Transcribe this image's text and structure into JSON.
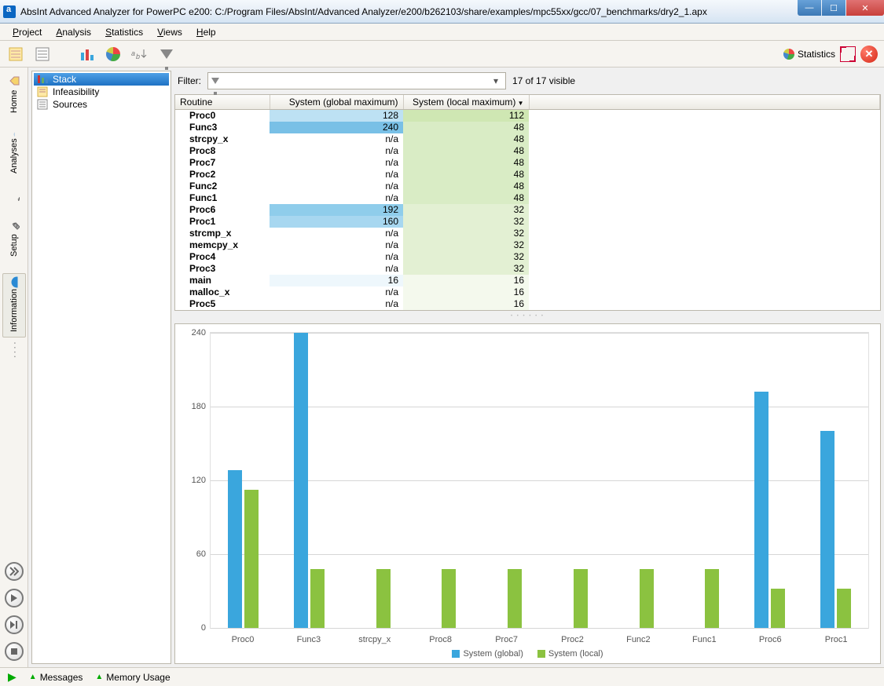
{
  "window": {
    "title": "AbsInt Advanced Analyzer for PowerPC e200: C:/Program Files/AbsInt/Advanced Analyzer/e200/b262103/share/examples/mpc55xx/gcc/07_benchmarks/dry2_1.apx"
  },
  "menus": {
    "project": "Project",
    "analysis": "Analysis",
    "statistics": "Statistics",
    "views": "Views",
    "help": "Help"
  },
  "toolbar": {
    "stats_label": "Statistics"
  },
  "vtabs": {
    "home": "Home",
    "analyses": "Analyses",
    "setup": "Setup",
    "information": "Information"
  },
  "tree": {
    "items": [
      "Stack",
      "Infeasibility",
      "Sources"
    ]
  },
  "filter": {
    "label": "Filter:",
    "visible_text": "17 of 17 visible"
  },
  "table": {
    "headers": [
      "Routine",
      "System (global maximum)",
      "System (local maximum)"
    ],
    "rows": [
      {
        "routine": "Proc0",
        "global": "128",
        "local": "112",
        "g_bg": "#bde1f3",
        "l_bg": "#cfe7b3"
      },
      {
        "routine": "Func3",
        "global": "240",
        "local": "48",
        "g_bg": "#79c0e6",
        "l_bg": "#d9ecc5"
      },
      {
        "routine": "strcpy_x",
        "global": "n/a",
        "local": "48",
        "g_bg": "",
        "l_bg": "#d9ecc5"
      },
      {
        "routine": "Proc8",
        "global": "n/a",
        "local": "48",
        "g_bg": "",
        "l_bg": "#d9ecc5"
      },
      {
        "routine": "Proc7",
        "global": "n/a",
        "local": "48",
        "g_bg": "",
        "l_bg": "#d9ecc5"
      },
      {
        "routine": "Proc2",
        "global": "n/a",
        "local": "48",
        "g_bg": "",
        "l_bg": "#d9ecc5"
      },
      {
        "routine": "Func2",
        "global": "n/a",
        "local": "48",
        "g_bg": "",
        "l_bg": "#d9ecc5"
      },
      {
        "routine": "Func1",
        "global": "n/a",
        "local": "48",
        "g_bg": "",
        "l_bg": "#d9ecc5"
      },
      {
        "routine": "Proc6",
        "global": "192",
        "local": "32",
        "g_bg": "#8fcdeb",
        "l_bg": "#e3f0d3"
      },
      {
        "routine": "Proc1",
        "global": "160",
        "local": "32",
        "g_bg": "#a7d7f0",
        "l_bg": "#e3f0d3"
      },
      {
        "routine": "strcmp_x",
        "global": "n/a",
        "local": "32",
        "g_bg": "",
        "l_bg": "#e3f0d3"
      },
      {
        "routine": "memcpy_x",
        "global": "n/a",
        "local": "32",
        "g_bg": "",
        "l_bg": "#e3f0d3"
      },
      {
        "routine": "Proc4",
        "global": "n/a",
        "local": "32",
        "g_bg": "",
        "l_bg": "#e3f0d3"
      },
      {
        "routine": "Proc3",
        "global": "n/a",
        "local": "32",
        "g_bg": "",
        "l_bg": "#e3f0d3"
      },
      {
        "routine": "main",
        "global": "16",
        "local": "16",
        "g_bg": "#eef7fc",
        "l_bg": "#f4f9ed"
      },
      {
        "routine": "malloc_x",
        "global": "n/a",
        "local": "16",
        "g_bg": "",
        "l_bg": "#f4f9ed"
      },
      {
        "routine": "Proc5",
        "global": "n/a",
        "local": "16",
        "g_bg": "",
        "l_bg": "#f4f9ed"
      }
    ]
  },
  "chart_data": {
    "type": "bar",
    "categories": [
      "Proc0",
      "Func3",
      "strcpy_x",
      "Proc8",
      "Proc7",
      "Proc2",
      "Func2",
      "Func1",
      "Proc6",
      "Proc1"
    ],
    "series": [
      {
        "name": "System (global)",
        "color": "#3aa6dd",
        "values": [
          128,
          240,
          null,
          null,
          null,
          null,
          null,
          null,
          192,
          160
        ]
      },
      {
        "name": "System (local)",
        "color": "#8bc240",
        "values": [
          112,
          48,
          48,
          48,
          48,
          48,
          48,
          48,
          32,
          32
        ]
      }
    ],
    "ylim": [
      0,
      240
    ],
    "yticks": [
      0,
      60,
      120,
      180,
      240
    ]
  },
  "bottombar": {
    "messages": "Messages",
    "memory": "Memory Usage"
  }
}
